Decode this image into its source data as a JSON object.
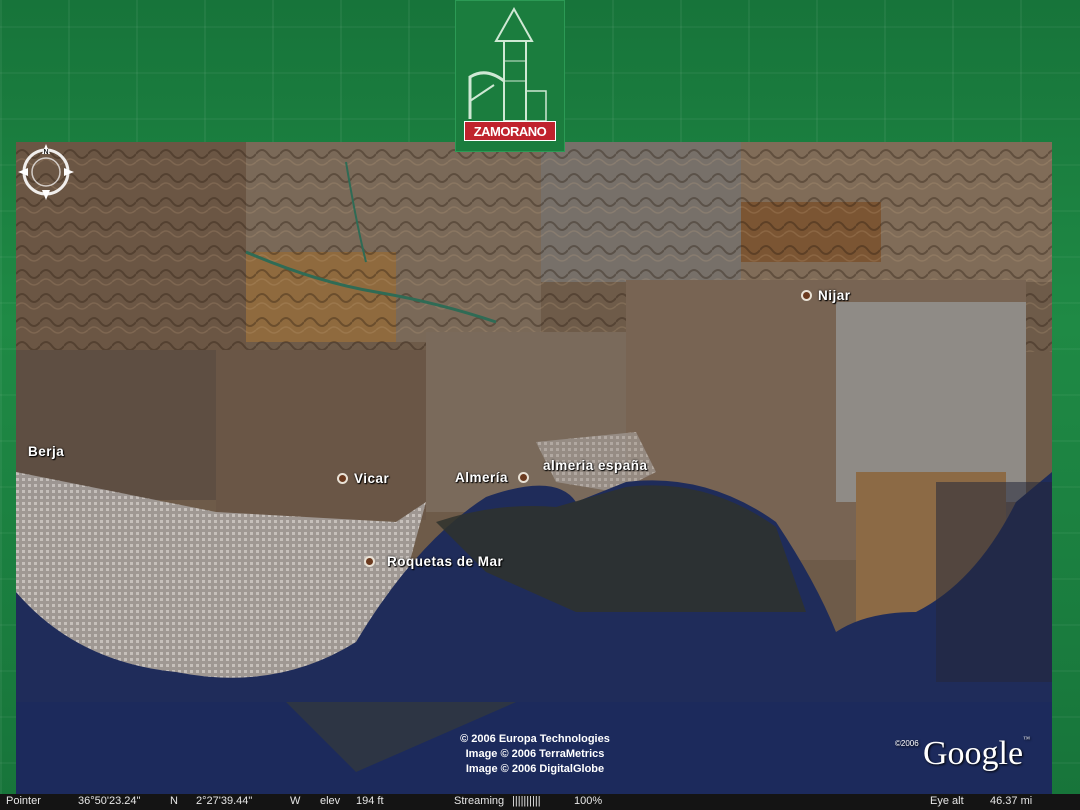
{
  "logo": {
    "text": "ZAMORANO"
  },
  "places": [
    {
      "name": "Nijar",
      "type": "town"
    },
    {
      "name": "Berja",
      "type": "town"
    },
    {
      "name": "Vicar",
      "type": "town"
    },
    {
      "name": "Almería",
      "type": "city"
    },
    {
      "name": "almeria españa",
      "type": "search-result"
    },
    {
      "name": "Roquetas de Mar",
      "type": "town"
    }
  ],
  "attribution": {
    "line1": "© 2006 Europa Technologies",
    "line2": "Image © 2006 TerraMetrics",
    "line3": "Image © 2006 DigitalGlobe"
  },
  "brand": {
    "year": "©2006",
    "name": "Google",
    "tm": "™"
  },
  "status": {
    "pointer_label": "Pointer",
    "lat": "36°50'23.24\"",
    "lat_hem": "N",
    "lon": "2°27'39.44\"",
    "lon_hem": "W",
    "elev_label": "elev",
    "elev": "194 ft",
    "streaming_label": "Streaming",
    "streaming_bar": "||||||||||",
    "streaming_pct": "100%",
    "eye_label": "Eye alt",
    "eye_value": "46.37 mi"
  },
  "colors": {
    "sea": "#1c2a5c",
    "land": "#7a6552",
    "frame": "#1d7a3a",
    "brand_red": "#c0232d"
  }
}
